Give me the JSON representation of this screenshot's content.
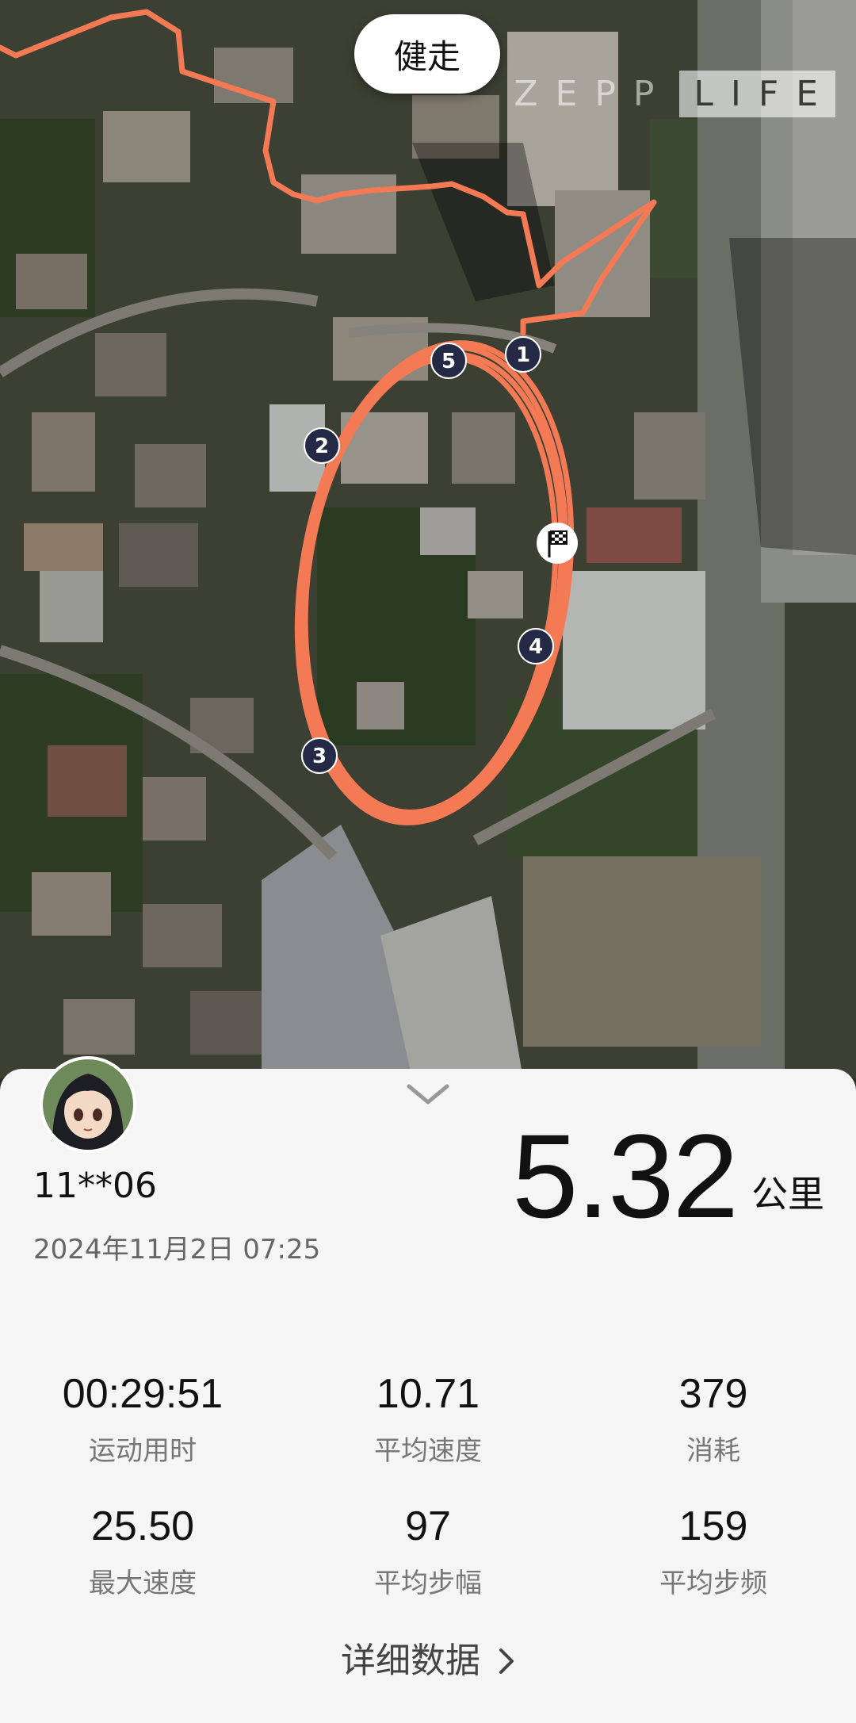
{
  "activity": {
    "type": "健走"
  },
  "brand": {
    "part1": "ZEPP",
    "part2": "LIFE"
  },
  "route": {
    "color": "#f47a55",
    "markers": [
      "1",
      "2",
      "3",
      "4",
      "5"
    ]
  },
  "user": {
    "name": "11**06",
    "datetime": "2024年11月2日 07:25"
  },
  "distance": {
    "value": "5.32",
    "unit": "公里"
  },
  "stats": [
    {
      "value": "00:29:51",
      "label": "运动用时"
    },
    {
      "value": "10.71",
      "label": "平均速度"
    },
    {
      "value": "379",
      "label": "消耗"
    },
    {
      "value": "25.50",
      "label": "最大速度"
    },
    {
      "value": "97",
      "label": "平均步幅"
    },
    {
      "value": "159",
      "label": "平均步频"
    }
  ],
  "details_link": {
    "label": "详细数据"
  }
}
